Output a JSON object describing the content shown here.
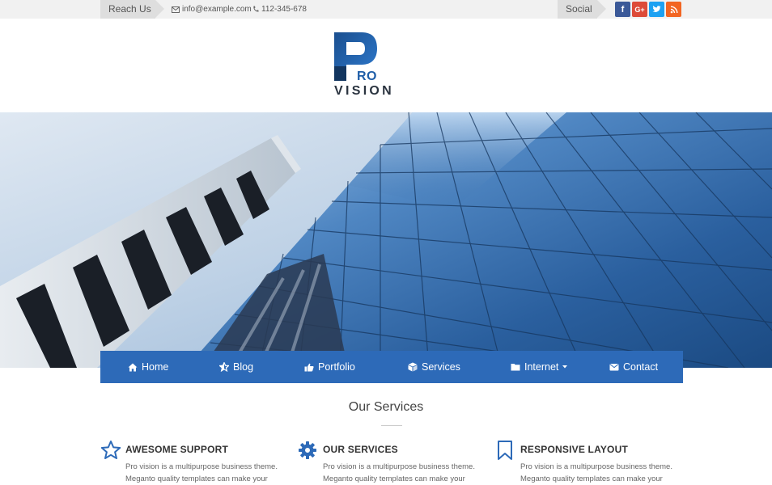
{
  "topbar": {
    "reach_label": "Reach Us",
    "email": "info@example.com",
    "phone": "112-345-678",
    "social_label": "Social",
    "social_icons": [
      {
        "icon": "facebook-icon",
        "glyph": "f",
        "color": "#3b5998"
      },
      {
        "icon": "google-plus-icon",
        "glyph": "G+",
        "color": "#dd4b39"
      },
      {
        "icon": "twitter-icon",
        "glyph": "t",
        "color": "#1da1f2"
      },
      {
        "icon": "rss-icon",
        "glyph": "rss",
        "color": "#f26522"
      }
    ]
  },
  "logo": {
    "line1": "RO",
    "line2": "VISION",
    "brand_color": "#1f5ea8"
  },
  "nav": {
    "color": "#2d6ab8",
    "items": [
      {
        "label": "Home",
        "icon": "home-icon"
      },
      {
        "label": "Blog",
        "icon": "star-icon"
      },
      {
        "label": "Portfolio",
        "icon": "thumbs-up-icon"
      },
      {
        "label": "Services",
        "icon": "cube-icon"
      },
      {
        "label": "Internet",
        "icon": "folder-icon",
        "dropdown": true
      },
      {
        "label": "Contact",
        "icon": "envelope-icon"
      }
    ]
  },
  "services": {
    "title": "Our Services",
    "items": [
      {
        "icon": "star-outline-icon",
        "title": "AWESOME SUPPORT",
        "text": "Pro vision is a multipurpose business theme. Meganto quality templates can make your"
      },
      {
        "icon": "gear-icon",
        "title": "OUR SERVICES",
        "text": "Pro vision is a multipurpose business theme. Meganto quality templates can make your"
      },
      {
        "icon": "bookmark-icon",
        "title": "RESPONSIVE LAYOUT",
        "text": "Pro vision is a multipurpose business theme. Meganto quality templates can make your"
      }
    ]
  }
}
